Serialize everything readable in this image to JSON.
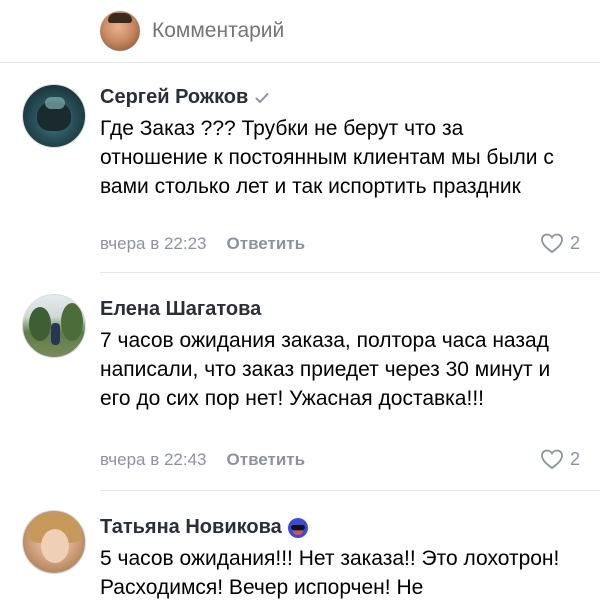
{
  "composer": {
    "placeholder": "Комментарий"
  },
  "comments": [
    {
      "author": "Сергей Рожков",
      "badge_icon": "verified-check-icon",
      "text": "Где Заказ ??? Трубки не берут что за отношение к постоянным клиентам мы были с вами столько лет и так испортить праздник",
      "time": "вчера в 22:23",
      "reply_label": "Ответить",
      "likes": "2"
    },
    {
      "author": "Елена Шагатова",
      "text": "7 часов ожидания заказа, полтора часа назад написали, что заказ приедет через 30 минут и его до сих пор нет! Ужасная доставка!!!",
      "time": "вчера в 22:43",
      "reply_label": "Ответить",
      "likes": "2"
    },
    {
      "author": "Татьяна Новикова",
      "badge_icon": "mask-emoji-icon",
      "text": "5 часов ожидания!!! Нет заказа!! Это лохотрон! Расходимся! Вечер испорчен! Не"
    }
  ],
  "colors": {
    "meta_text": "#8a949f",
    "author_text": "#2a2f36",
    "divider": "#e3e6ea"
  }
}
